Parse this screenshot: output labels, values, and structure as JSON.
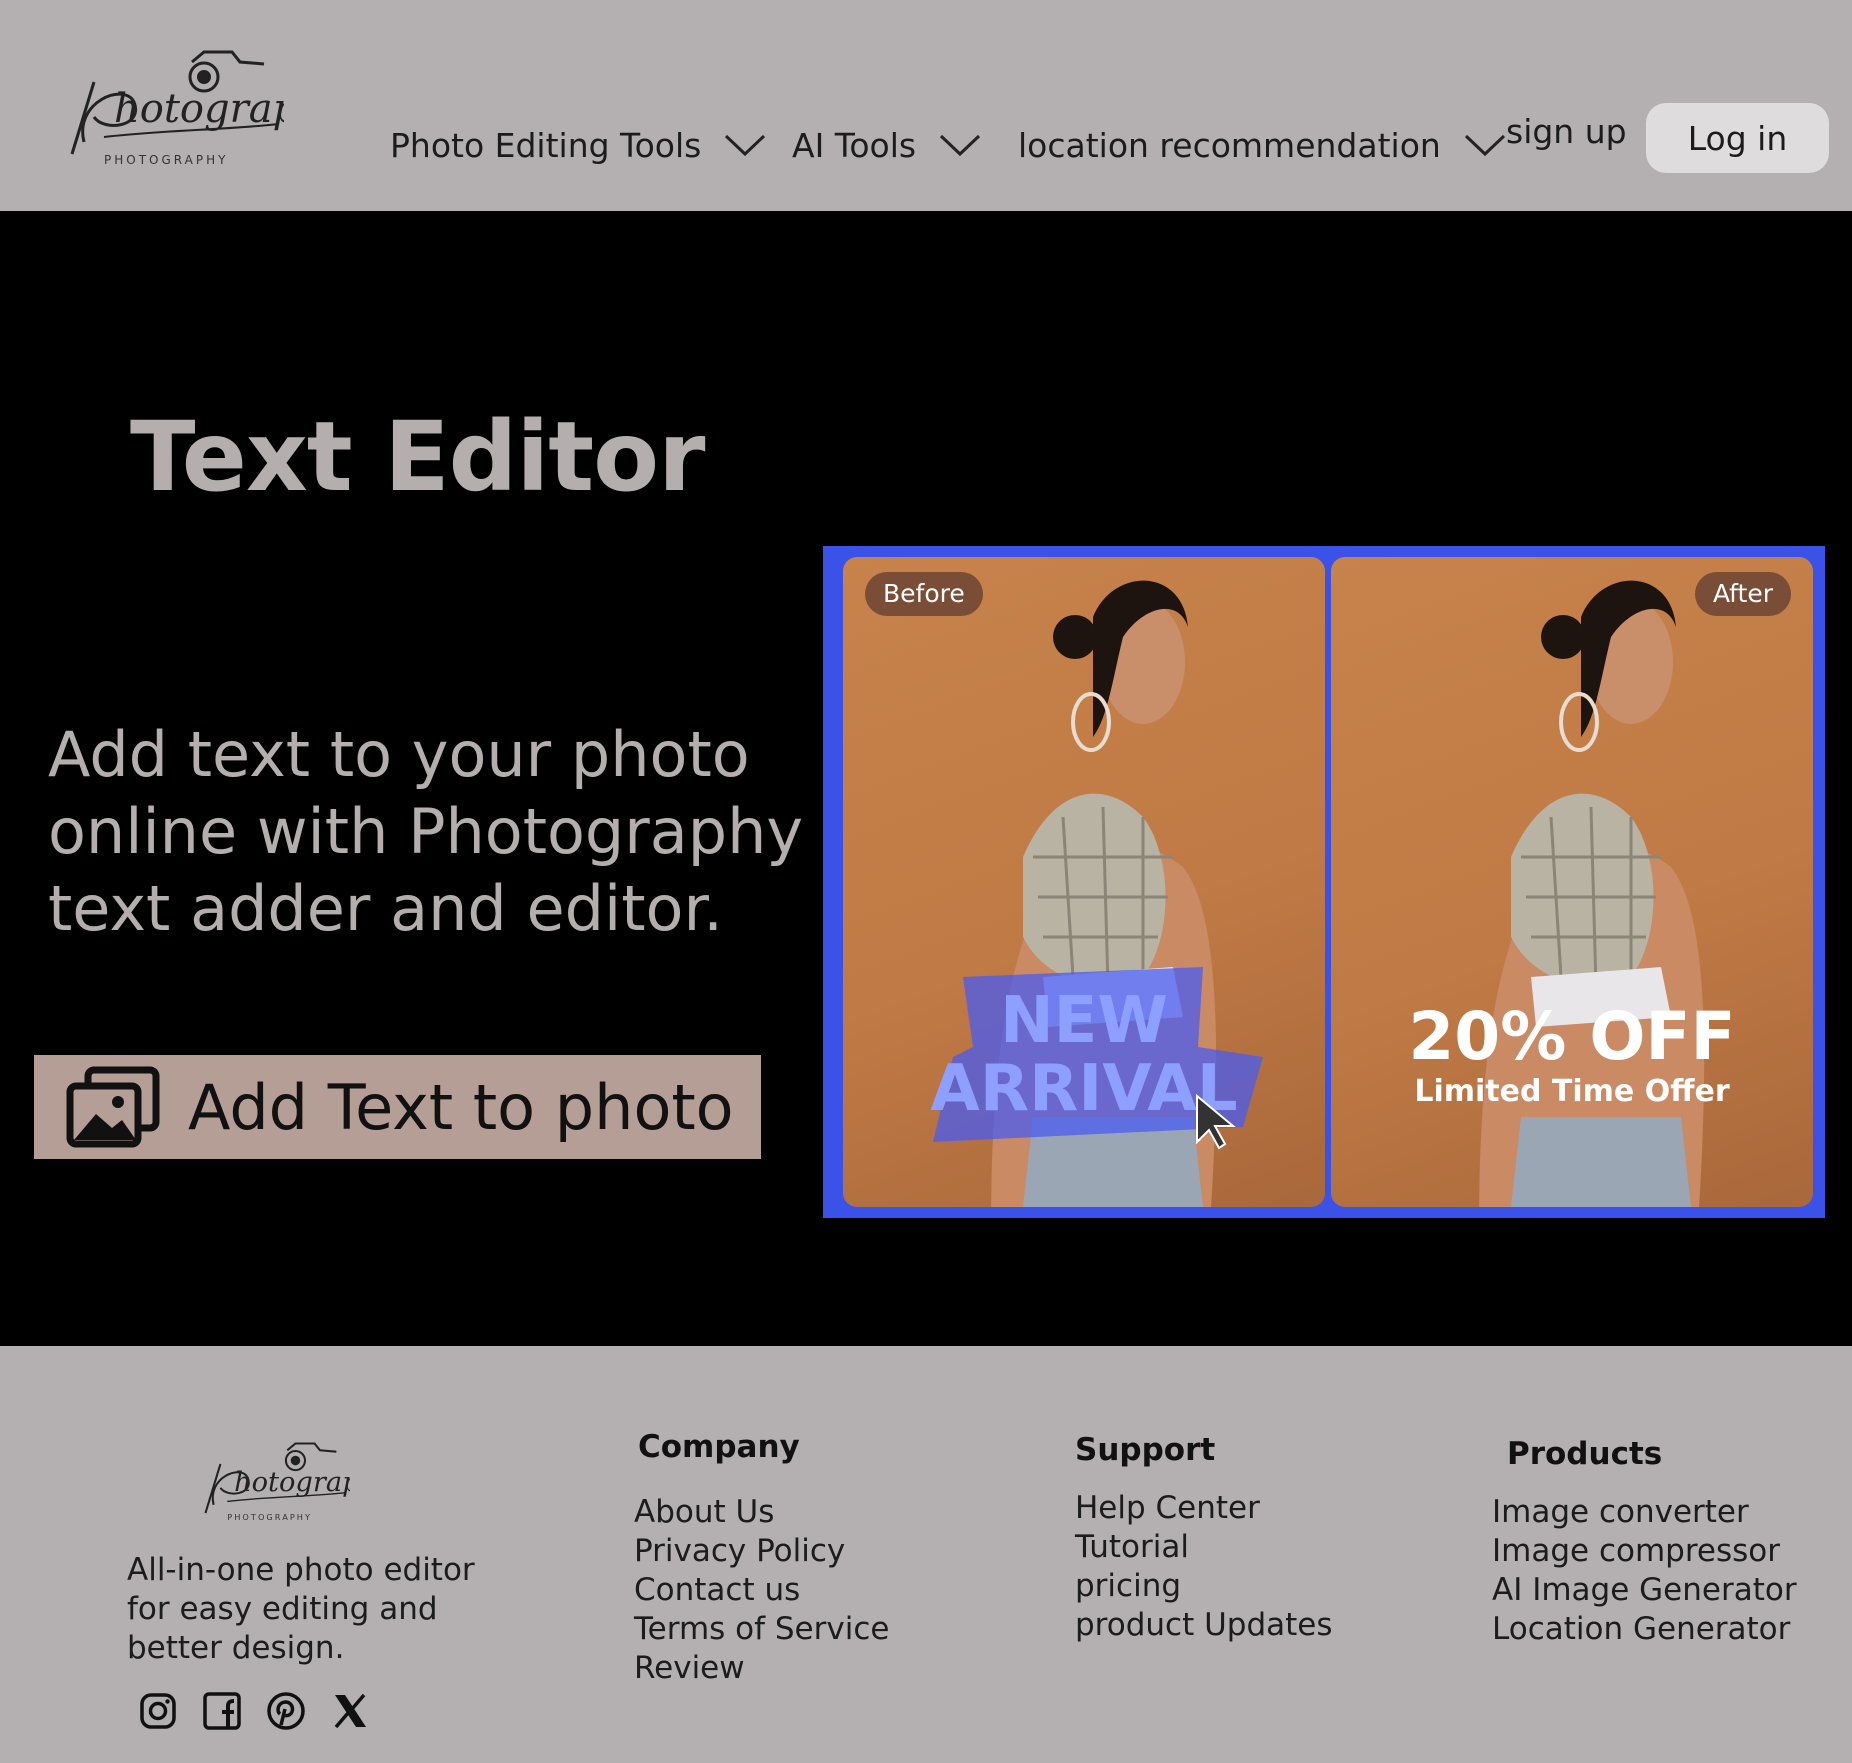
{
  "brand": {
    "logo_text": "Photography",
    "logo_subtext": "PHOTOGRAPHY"
  },
  "nav": {
    "items": [
      {
        "label": "Photo Editing Tools"
      },
      {
        "label": "AI Tools"
      },
      {
        "label": "location recommendation"
      }
    ],
    "signup_label": "sign up",
    "login_label": "Log in"
  },
  "hero": {
    "title": "Text Editor",
    "subtitle": "Add text to your photo online with Photography text adder and editor.",
    "cta_label": "Add Text to photo",
    "before_label": "Before",
    "after_label": "After",
    "before_overlay_line1": "NEW",
    "before_overlay_line2": "ARRIVAL",
    "after_overlay_line1": "20% OFF",
    "after_overlay_line2": "Limited Time Offer"
  },
  "footer": {
    "description": "All-in-one photo editor for easy editing and better design.",
    "columns": [
      {
        "heading": "Company",
        "links": [
          "About Us",
          "Privacy Policy",
          "Contact us",
          "Terms of Service",
          "Review"
        ]
      },
      {
        "heading": "Support",
        "links": [
          "Help Center",
          "Tutorial",
          "pricing",
          "product Updates"
        ]
      },
      {
        "heading": "Products",
        "links": [
          "Image converter",
          "Image compressor",
          "AI Image Generator",
          "Location Generator"
        ]
      }
    ],
    "social_icons": [
      "instagram-icon",
      "facebook-icon",
      "pinterest-icon",
      "x-icon"
    ]
  },
  "colors": {
    "header_bg": "#b4afb0",
    "hero_bg": "#000000",
    "hero_text": "#b4aeae",
    "cta_bg": "#b59e95",
    "panel_border": "#3a52e8",
    "login_bg": "#dedcdc"
  }
}
